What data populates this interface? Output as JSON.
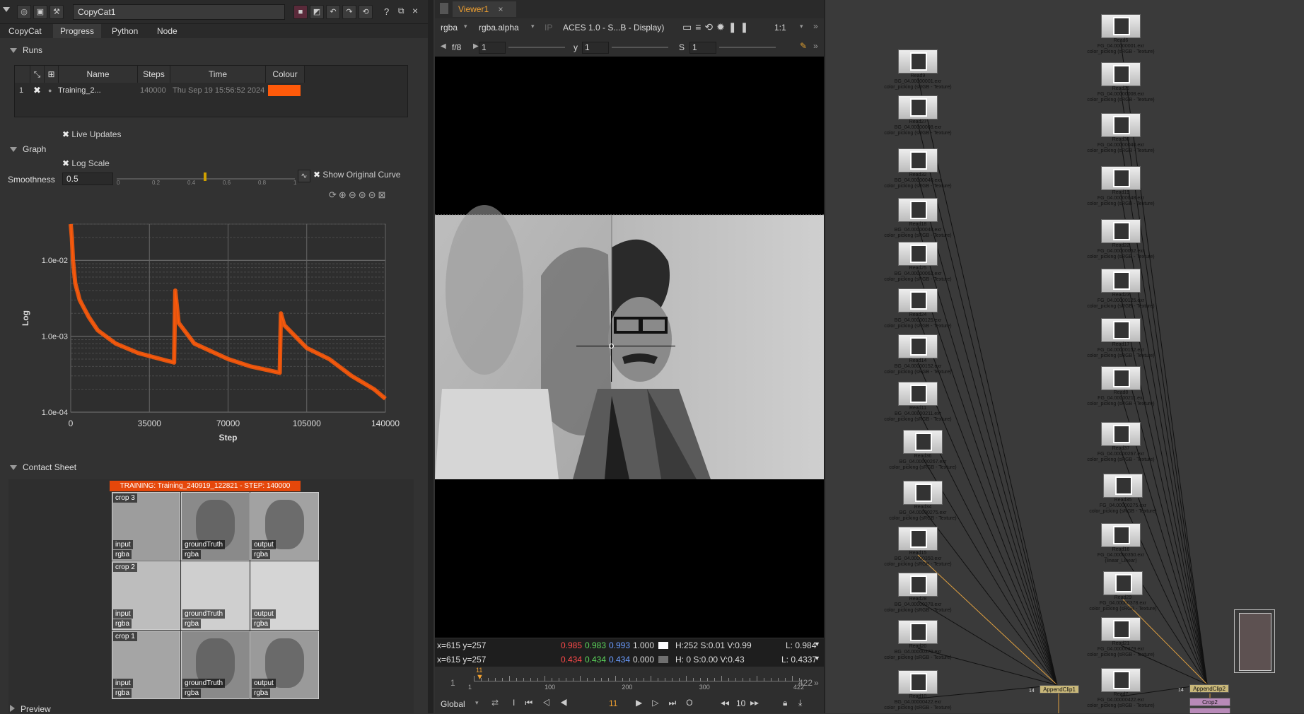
{
  "properties": {
    "node_name": "CopyCat1",
    "tabs": [
      "CopyCat",
      "Progress",
      "Python",
      "Node"
    ],
    "active_tab": "Progress",
    "runs_label": "Runs",
    "runs_columns": [
      "Name",
      "Steps",
      "Time",
      "Colour"
    ],
    "run_row": {
      "index": "1",
      "name": "Training_2...",
      "steps": "140000",
      "time": "Thu Sep 19 15:56:52 2024",
      "colour": "#ff5a0a"
    },
    "live_updates_label": "Live Updates",
    "graph_label": "Graph",
    "log_scale_label": "Log Scale",
    "smoothness_label": "Smoothness",
    "smoothness_value": "0.5",
    "slider_ticks": [
      "0",
      "0.2",
      "0.4",
      "0.6",
      "0.8",
      "1"
    ],
    "show_original_label": "Show Original Curve",
    "contact_sheet_label": "Contact Sheet",
    "contact_banner": "TRAINING: Training_240919_122821 - STEP: 140000",
    "preview_label": "Preview",
    "crops": [
      {
        "crop": "crop 3",
        "cells": [
          "input",
          "groundTruth",
          "output"
        ]
      },
      {
        "crop": "crop 2",
        "cells": [
          "input",
          "groundTruth",
          "output"
        ]
      },
      {
        "crop": "crop 1",
        "cells": [
          "input",
          "groundTruth",
          "output"
        ]
      }
    ],
    "channel_label": "rgba"
  },
  "chart_data": {
    "type": "line",
    "ylabel": "Log",
    "xlabel": "Step",
    "xlim": [
      0,
      140000
    ],
    "ylim": [
      0.0001,
      0.03
    ],
    "yscale": "log",
    "x_ticks": [
      "0",
      "35000",
      "70000",
      "105000",
      "140000"
    ],
    "y_ticks": [
      "1.0e-02",
      "1.0e-03",
      "1.0e-04"
    ],
    "series": [
      {
        "color": "#ff5a0a",
        "x": [
          0,
          500,
          1000,
          2000,
          4000,
          8000,
          12000,
          20000,
          30000,
          40000,
          46000,
          46500,
          48000,
          55000,
          70000,
          80000,
          93000,
          93500,
          95000,
          105000,
          115000,
          125000,
          135000,
          140000
        ],
        "values": [
          0.03,
          0.02,
          0.01,
          0.005,
          0.003,
          0.0018,
          0.0012,
          0.0008,
          0.0006,
          0.0005,
          0.00045,
          0.004,
          0.0015,
          0.0008,
          0.0005,
          0.0004,
          0.00033,
          0.002,
          0.0014,
          0.0007,
          0.0005,
          0.0003,
          0.0002,
          0.00015
        ]
      }
    ],
    "grid": true
  },
  "viewer": {
    "tab_label": "Viewer1",
    "channels": "rgba",
    "alpha_channel": "rgba.alpha",
    "ip_label": "IP",
    "colorspace": "ACES 1.0 - S...B - Display)",
    "zoom": "1:1",
    "fstop": "f/8",
    "gain_value": "1",
    "y_label": "y",
    "y_value": "1",
    "s_label": "S",
    "s_value": "1",
    "status1": {
      "coords": "x=615 y=257",
      "r": "0.985",
      "g": "0.983",
      "b": "0.993",
      "a": "1.000",
      "hsv": "H:252 S:0.01 V:0.99",
      "l": "L: 0.984"
    },
    "status2": {
      "coords": "x=615 y=257",
      "r": "0.434",
      "g": "0.434",
      "b": "0.434",
      "a": "0.000",
      "hsv": "H:  0 S:0.00 V:0.43",
      "l": "L: 0.4337"
    },
    "timeline": {
      "start": "1",
      "end": "422",
      "current_marker": "11",
      "ticks": [
        "1",
        "100",
        "200",
        "300",
        "422"
      ]
    },
    "playback": {
      "scope": "Global",
      "frame": "11",
      "step": "10"
    }
  },
  "dag": {
    "left_nodes": [
      {
        "name": "Read9",
        "file": "BG_04.00000001.exr"
      },
      {
        "name": "Read27",
        "file": "BG_04.00000008.exr"
      },
      {
        "name": "Read32",
        "file": "BG_04.00000040.exr"
      },
      {
        "name": "Read18",
        "file": "BG_04.00000048.exr"
      },
      {
        "name": "Read25",
        "file": "BG_04.00000062.exr"
      },
      {
        "name": "Read24",
        "file": "BG_04.00000125.exr"
      },
      {
        "name": "Read14",
        "file": "BG_04.00000152.exr"
      },
      {
        "name": "Read11",
        "file": "BG_04.00000211.exr"
      },
      {
        "name": "Read36",
        "file": "BG_04.00000267.exr"
      },
      {
        "name": "Read34",
        "file": "BG_04.00000275.exr"
      },
      {
        "name": "Read15",
        "file": "BG_04.00000350.exr"
      },
      {
        "name": "Read28",
        "file": "BG_04.00000378.exr"
      },
      {
        "name": "Read20",
        "file": "BG_04.00000379.exr"
      },
      {
        "name": "Read10",
        "file": "BG_04.00000422.exr"
      }
    ],
    "right_nodes": [
      {
        "name": "Read6",
        "file": "FG_04.00000001.exr"
      },
      {
        "name": "Read26",
        "file": "FG_04.00000008.exr"
      },
      {
        "name": "Read30",
        "file": "FG_04.00000040.exr"
      },
      {
        "name": "Read19",
        "file": "FG_04.00000048.exr"
      },
      {
        "name": "Read22",
        "file": "FG_04.00000062.exr"
      },
      {
        "name": "Read23",
        "file": "FG_04.00000125.exr"
      },
      {
        "name": "Read17",
        "file": "FG_04.00000152.exr"
      },
      {
        "name": "Read8",
        "file": "FG_04.00000211.exr"
      },
      {
        "name": "Read37",
        "file": "FG_04.00000267.exr"
      },
      {
        "name": "Read35",
        "file": "FG_04.00000275.exr"
      },
      {
        "name": "Read16",
        "file": "FG_04.00000350.exr"
      },
      {
        "name": "Read29",
        "file": "FG_04.00000378.exr"
      },
      {
        "name": "Read21",
        "file": "FG_04.00000379.exr"
      },
      {
        "name": "Read7",
        "file": "FG_04.00000422.exr"
      }
    ],
    "colorspace_label": "color_picking (sRGB - Texture)",
    "alt_colorspace_label": "(linear_Linear)",
    "append_left": "AppendClip1",
    "append_right": "AppendClip2",
    "crop_label": "Crop2",
    "input_count": "14"
  }
}
